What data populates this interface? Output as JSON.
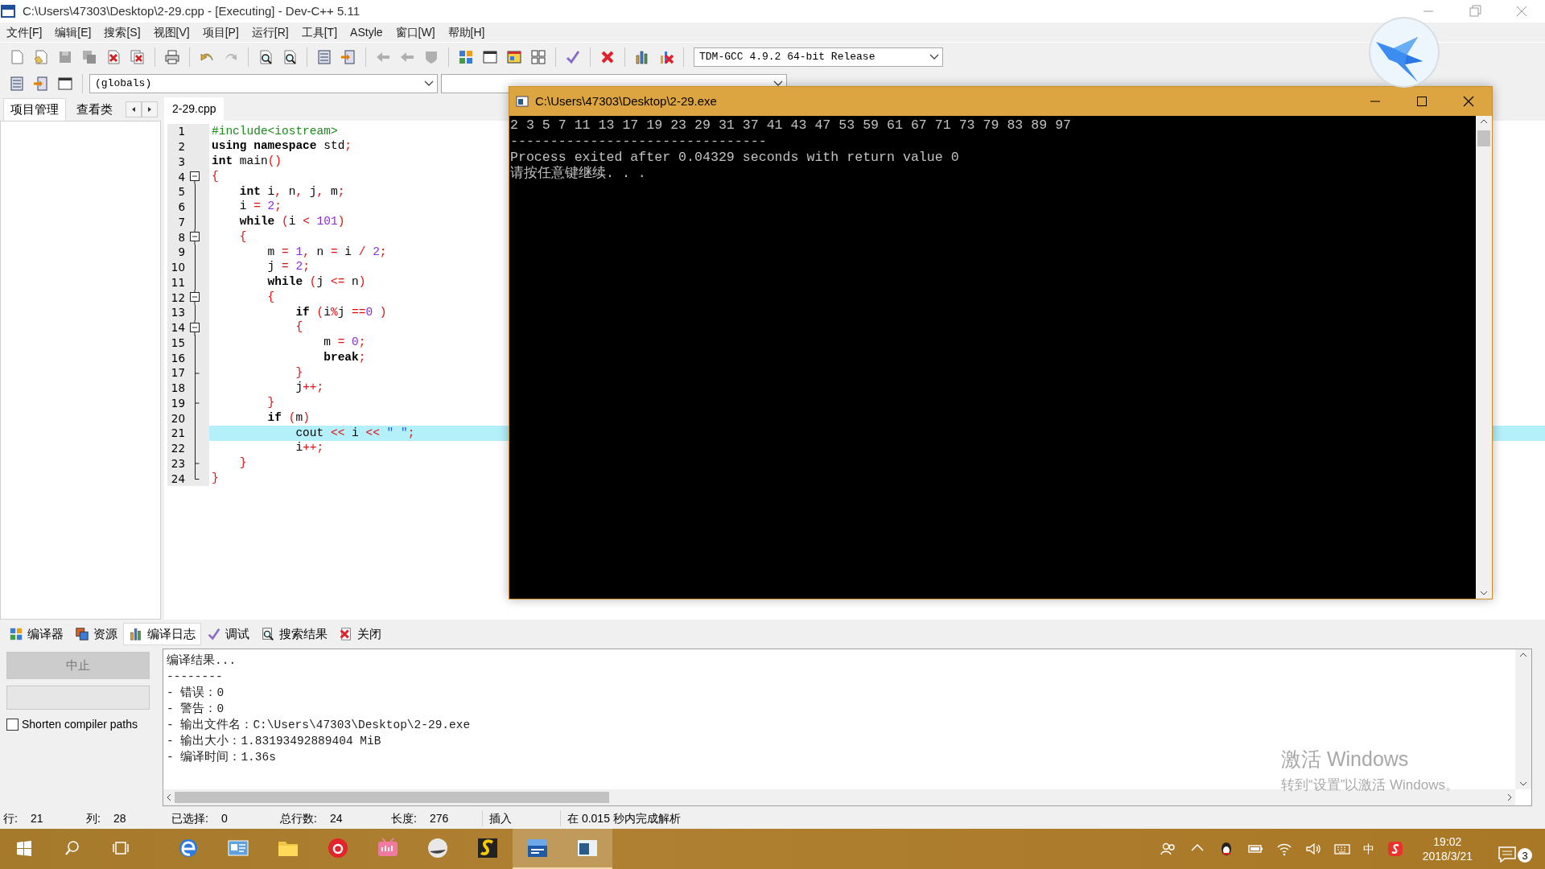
{
  "window": {
    "title": "C:\\Users\\47303\\Desktop\\2-29.cpp - [Executing] - Dev-C++ 5.11"
  },
  "menu": [
    "文件[F]",
    "编辑[E]",
    "搜索[S]",
    "视图[V]",
    "项目[P]",
    "运行[R]",
    "工具[T]",
    "AStyle",
    "窗口[W]",
    "帮助[H]"
  ],
  "toolbar": {
    "compiler": "TDM-GCC 4.9.2 64-bit Release",
    "scope": "(globals)"
  },
  "project_panel": {
    "tabs": [
      {
        "label": "项目管理",
        "selected": true
      },
      {
        "label": "查看类",
        "selected": false
      }
    ]
  },
  "editor": {
    "tabs": [
      {
        "label": "2-29.cpp",
        "selected": true
      }
    ],
    "lines": [
      {
        "number": "1",
        "highlighted": false,
        "kind": "plain",
        "tokens": [
          {
            "kind": "pp",
            "text": "#include<iostream>"
          }
        ]
      },
      {
        "number": "2",
        "highlighted": false,
        "kind": "plain",
        "tokens": [
          {
            "kind": "kw",
            "text": "using namespace"
          },
          {
            "kind": "id",
            "text": " std"
          },
          {
            "kind": "sym",
            "text": ";"
          }
        ]
      },
      {
        "number": "3",
        "highlighted": false,
        "kind": "plain",
        "tokens": [
          {
            "kind": "kw",
            "text": "int"
          },
          {
            "kind": "id",
            "text": " main"
          },
          {
            "kind": "sym",
            "text": "()"
          }
        ]
      },
      {
        "number": "4",
        "highlighted": false,
        "kind": "open",
        "tokens": [
          {
            "kind": "sym",
            "text": "{"
          }
        ]
      },
      {
        "number": "5",
        "highlighted": false,
        "kind": "plain",
        "tokens": [
          {
            "kind": "kw",
            "text": "    int"
          },
          {
            "kind": "id",
            "text": " i"
          },
          {
            "kind": "sym",
            "text": ","
          },
          {
            "kind": "id",
            "text": " n"
          },
          {
            "kind": "sym",
            "text": ","
          },
          {
            "kind": "id",
            "text": " j"
          },
          {
            "kind": "sym",
            "text": ","
          },
          {
            "kind": "id",
            "text": " m"
          },
          {
            "kind": "sym",
            "text": ";"
          }
        ]
      },
      {
        "number": "6",
        "highlighted": false,
        "kind": "plain",
        "tokens": [
          {
            "kind": "id",
            "text": "    i "
          },
          {
            "kind": "sym",
            "text": "="
          },
          {
            "kind": "num",
            "text": " 2"
          },
          {
            "kind": "sym",
            "text": ";"
          }
        ]
      },
      {
        "number": "7",
        "highlighted": false,
        "kind": "plain",
        "tokens": [
          {
            "kind": "kw",
            "text": "    while "
          },
          {
            "kind": "sym",
            "text": "("
          },
          {
            "kind": "id",
            "text": "i "
          },
          {
            "kind": "sym",
            "text": "<"
          },
          {
            "kind": "num",
            "text": " 101"
          },
          {
            "kind": "sym",
            "text": ")"
          }
        ]
      },
      {
        "number": "8",
        "highlighted": false,
        "kind": "open",
        "tokens": [
          {
            "kind": "sym",
            "text": "    {"
          }
        ]
      },
      {
        "number": "9",
        "highlighted": false,
        "kind": "plain",
        "tokens": [
          {
            "kind": "id",
            "text": "        m "
          },
          {
            "kind": "sym",
            "text": "="
          },
          {
            "kind": "num",
            "text": " 1"
          },
          {
            "kind": "sym",
            "text": ","
          },
          {
            "kind": "id",
            "text": " n "
          },
          {
            "kind": "sym",
            "text": "="
          },
          {
            "kind": "id",
            "text": " i "
          },
          {
            "kind": "sym",
            "text": "/"
          },
          {
            "kind": "num",
            "text": " 2"
          },
          {
            "kind": "sym",
            "text": ";"
          }
        ]
      },
      {
        "number": "10",
        "highlighted": false,
        "kind": "plain",
        "tokens": [
          {
            "kind": "id",
            "text": "        j "
          },
          {
            "kind": "sym",
            "text": "="
          },
          {
            "kind": "num",
            "text": " 2"
          },
          {
            "kind": "sym",
            "text": ";"
          }
        ]
      },
      {
        "number": "11",
        "highlighted": false,
        "kind": "plain",
        "tokens": [
          {
            "kind": "kw",
            "text": "        while "
          },
          {
            "kind": "sym",
            "text": "("
          },
          {
            "kind": "id",
            "text": "j "
          },
          {
            "kind": "sym",
            "text": "<="
          },
          {
            "kind": "id",
            "text": " n"
          },
          {
            "kind": "sym",
            "text": ")"
          }
        ]
      },
      {
        "number": "12",
        "highlighted": false,
        "kind": "open",
        "tokens": [
          {
            "kind": "sym",
            "text": "        {"
          }
        ]
      },
      {
        "number": "13",
        "highlighted": false,
        "kind": "plain",
        "tokens": [
          {
            "kind": "kw",
            "text": "            if "
          },
          {
            "kind": "sym",
            "text": "("
          },
          {
            "kind": "id",
            "text": "i"
          },
          {
            "kind": "sym",
            "text": "%"
          },
          {
            "kind": "id",
            "text": "j "
          },
          {
            "kind": "sym",
            "text": "=="
          },
          {
            "kind": "num",
            "text": "0 "
          },
          {
            "kind": "sym",
            "text": ")"
          }
        ]
      },
      {
        "number": "14",
        "highlighted": false,
        "kind": "open",
        "tokens": [
          {
            "kind": "sym",
            "text": "            {"
          }
        ]
      },
      {
        "number": "15",
        "highlighted": false,
        "kind": "plain",
        "tokens": [
          {
            "kind": "id",
            "text": "                m "
          },
          {
            "kind": "sym",
            "text": "="
          },
          {
            "kind": "num",
            "text": " 0"
          },
          {
            "kind": "sym",
            "text": ";"
          }
        ]
      },
      {
        "number": "16",
        "highlighted": false,
        "kind": "plain",
        "tokens": [
          {
            "kind": "kw",
            "text": "                break"
          },
          {
            "kind": "sym",
            "text": ";"
          }
        ]
      },
      {
        "number": "17",
        "highlighted": false,
        "kind": "close",
        "tokens": [
          {
            "kind": "sym",
            "text": "            }"
          }
        ]
      },
      {
        "number": "18",
        "highlighted": false,
        "kind": "plain",
        "tokens": [
          {
            "kind": "id",
            "text": "            j"
          },
          {
            "kind": "sym",
            "text": "++;"
          }
        ]
      },
      {
        "number": "19",
        "highlighted": false,
        "kind": "close",
        "tokens": [
          {
            "kind": "sym",
            "text": "        }"
          }
        ]
      },
      {
        "number": "20",
        "highlighted": false,
        "kind": "plain",
        "tokens": [
          {
            "kind": "kw",
            "text": "        if "
          },
          {
            "kind": "sym",
            "text": "("
          },
          {
            "kind": "id",
            "text": "m"
          },
          {
            "kind": "sym",
            "text": ")"
          }
        ]
      },
      {
        "number": "21",
        "highlighted": true,
        "kind": "plain",
        "tokens": [
          {
            "kind": "id",
            "text": "            cout "
          },
          {
            "kind": "sym",
            "text": "<<"
          },
          {
            "kind": "id",
            "text": " i "
          },
          {
            "kind": "sym",
            "text": "<<"
          },
          {
            "kind": "str",
            "text": " \" \""
          },
          {
            "kind": "sym",
            "text": ";"
          }
        ]
      },
      {
        "number": "22",
        "highlighted": false,
        "kind": "plain",
        "tokens": [
          {
            "kind": "id",
            "text": "            i"
          },
          {
            "kind": "sym",
            "text": "++;"
          }
        ]
      },
      {
        "number": "23",
        "highlighted": false,
        "kind": "close",
        "tokens": [
          {
            "kind": "sym",
            "text": "    }"
          }
        ]
      },
      {
        "number": "24",
        "highlighted": false,
        "kind": "last",
        "tokens": [
          {
            "kind": "sym",
            "text": "}"
          }
        ]
      }
    ]
  },
  "console": {
    "title": "C:\\Users\\47303\\Desktop\\2-29.exe",
    "lines": [
      "2 3 5 7 11 13 17 19 23 29 31 37 41 43 47 53 59 61 67 71 73 79 83 89 97",
      "--------------------------------",
      "Process exited after 0.04329 seconds with return value 0",
      "请按任意键继续. . ."
    ]
  },
  "bottom_panel": {
    "tabs": [
      {
        "label": "编译器",
        "selected": false
      },
      {
        "label": "资源",
        "selected": false
      },
      {
        "label": "编译日志",
        "selected": true
      },
      {
        "label": "调试",
        "selected": false
      },
      {
        "label": "搜索结果",
        "selected": false
      },
      {
        "label": "关闭",
        "selected": false
      }
    ],
    "stop_button": {
      "label": "中止",
      "disabled": true
    },
    "progress": {
      "level": 0
    },
    "shorten_paths": {
      "label": "Shorten compiler paths",
      "checked": false
    },
    "log": [
      "编译结果...",
      "--------",
      "- 错误：0",
      "- 警告：0",
      "- 输出文件名：C:\\Users\\47303\\Desktop\\2-29.exe",
      "- 输出大小：1.83193492889404 MiB",
      "- 编译时间：1.36s"
    ]
  },
  "status_bar": {
    "fields": [
      {
        "label": "行:",
        "value": "21"
      },
      {
        "label": "列:",
        "value": "28"
      },
      {
        "label": "已选择:",
        "value": "0"
      },
      {
        "label": "总行数:",
        "value": "24"
      },
      {
        "label": "长度:",
        "value": "276"
      }
    ],
    "mode": "插入",
    "message": "在 0.015 秒内完成解析"
  },
  "activation_notice": {
    "title": "激活 Windows",
    "text": "转到“设置”以激活 Windows。"
  },
  "taskbar": {
    "apps": [
      {
        "kind": "browser",
        "selected": false
      },
      {
        "kind": "card",
        "selected": false
      },
      {
        "kind": "folder",
        "selected": false
      },
      {
        "kind": "music",
        "selected": false
      },
      {
        "kind": "video",
        "selected": false
      },
      {
        "kind": "ball",
        "selected": false
      },
      {
        "kind": "editor",
        "selected": false
      },
      {
        "kind": "ide",
        "selected": true
      },
      {
        "kind": "console",
        "selected": true
      }
    ],
    "ime": "中",
    "time": "19:02",
    "date": "2018/3/21",
    "notifications": "3"
  }
}
